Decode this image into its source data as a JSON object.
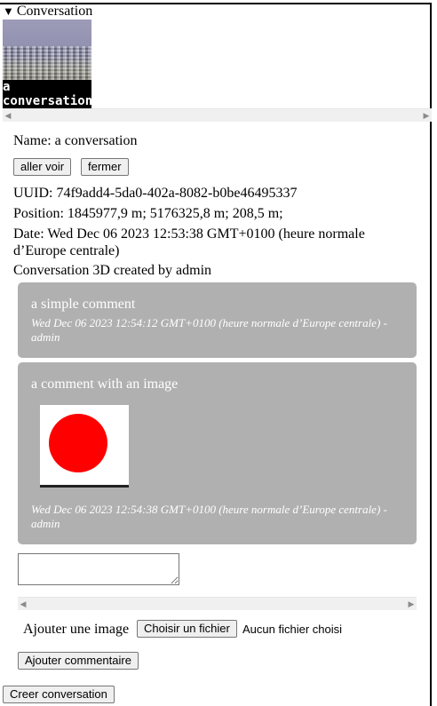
{
  "details": {
    "summary_label": "Conversation",
    "thumbnail_label": "a\nconversation"
  },
  "info": {
    "name": "Name: a conversation",
    "go_button": "aller voir",
    "close_button": "fermer",
    "uuid": "UUID: 74f9add4-5da0-402a-8082-b0be46495337",
    "position": "Position: 1845977,9 m; 5176325,8 m; 208,5 m;",
    "date": "Date: Wed Dec 06 2023 12:53:38 GMT+0100 (heure normale d’Europe centrale)",
    "created_by": "Conversation 3D created by admin"
  },
  "comments": [
    {
      "text": "a simple comment",
      "meta": "Wed Dec 06 2023 12:54:12 GMT+0100 (heure normale d’Europe centrale) - admin"
    },
    {
      "text": "a comment with an image",
      "meta": "Wed Dec 06 2023 12:54:38 GMT+0100 (heure normale d’Europe centrale) - admin"
    }
  ],
  "form": {
    "comment_value": "",
    "image_label": "Ajouter une image",
    "choose_file_button": "Choisir un fichier",
    "file_status": "Aucun fichier choisi",
    "add_comment_button": "Ajouter commentaire",
    "create_button": "Creer conversation"
  },
  "colors": {
    "comment_bg": "#b0b0b0",
    "image_dot": "#ff0000"
  }
}
